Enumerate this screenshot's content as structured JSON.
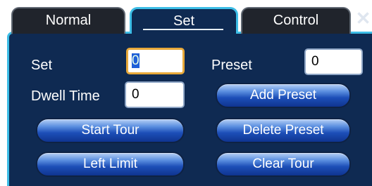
{
  "tabs": [
    {
      "label": "Normal"
    },
    {
      "label": "Set"
    },
    {
      "label": "Control"
    }
  ],
  "close_glyph": "✕",
  "form": {
    "set_label": "Set",
    "set_value": "0",
    "preset_label": "Preset",
    "preset_value": "0",
    "dwell_time_label": "Dwell Time",
    "dwell_time_value": "0"
  },
  "buttons": {
    "add_preset": "Add Preset",
    "start_tour": "Start Tour",
    "delete_preset": "Delete Preset",
    "left_limit": "Left Limit",
    "clear_tour": "Clear Tour"
  },
  "colors": {
    "panel_bg": "#0f2a52",
    "accent": "#3dbde6",
    "focus_border": "#e8a93a"
  }
}
